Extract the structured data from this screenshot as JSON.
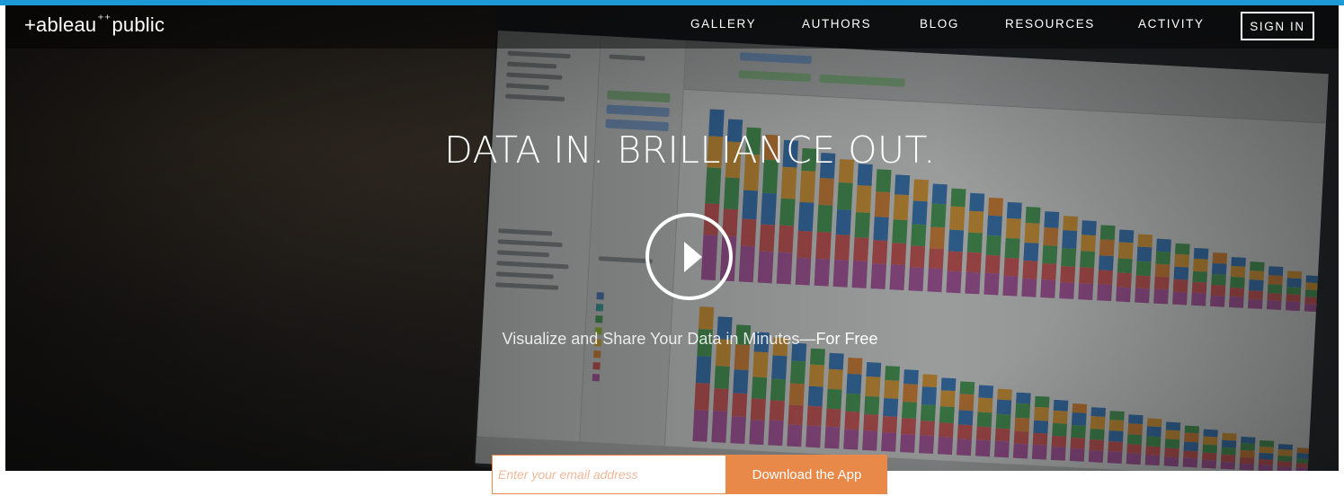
{
  "header": {
    "logo_left": "+ableau",
    "logo_spark": "⁺⁺",
    "logo_right": "public",
    "nav": [
      {
        "label": "GALLERY"
      },
      {
        "label": "AUTHORS"
      },
      {
        "label": "BLOG"
      },
      {
        "label": "RESOURCES"
      },
      {
        "label": "ACTIVITY"
      }
    ],
    "sign_in_label": "SIGN IN"
  },
  "hero": {
    "headline": "DATA IN. BRILLIANCE OUT.",
    "subhead_main": "Visualize and Share Your Data in Minutes—",
    "subhead_emphasis": "For Free",
    "play_icon": "play-icon"
  },
  "signup": {
    "email_placeholder": "Enter your email address",
    "email_value": "",
    "download_label": "Download the App"
  },
  "colors": {
    "accent_blue": "#1d9ad6",
    "cta_orange": "#e8894a",
    "white": "#ffffff"
  }
}
